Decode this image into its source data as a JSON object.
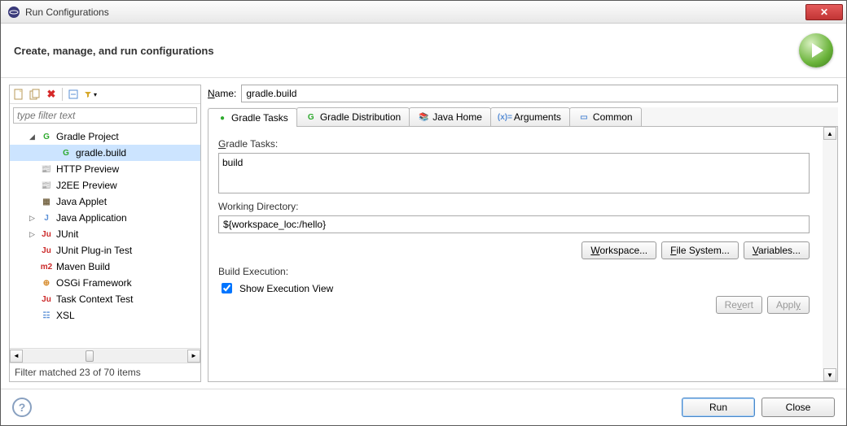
{
  "titlebar": {
    "title": "Run Configurations"
  },
  "header": {
    "title": "Create, manage, and run configurations"
  },
  "left": {
    "filter_placeholder": "type filter text",
    "tree": [
      {
        "label": "Gradle Project",
        "icon": "G",
        "iconColor": "#2faa2f",
        "expandable": true,
        "expanded": true,
        "level": 1
      },
      {
        "label": "gradle.build",
        "icon": "G",
        "iconColor": "#2faa2f",
        "level": 2,
        "selected": true
      },
      {
        "label": "HTTP Preview",
        "icon": "📰",
        "iconColor": "#5a8fd6",
        "level": 1
      },
      {
        "label": "J2EE Preview",
        "icon": "📰",
        "iconColor": "#5a8fd6",
        "level": 1
      },
      {
        "label": "Java Applet",
        "icon": "▦",
        "iconColor": "#7a6a4a",
        "level": 1
      },
      {
        "label": "Java Application",
        "icon": "J",
        "iconColor": "#5a8fd6",
        "expandable": true,
        "expanded": false,
        "level": 1
      },
      {
        "label": "JUnit",
        "icon": "Ju",
        "iconColor": "#cc2a2a",
        "expandable": true,
        "expanded": false,
        "level": 1
      },
      {
        "label": "JUnit Plug-in Test",
        "icon": "Ju",
        "iconColor": "#cc2a2a",
        "level": 1
      },
      {
        "label": "Maven Build",
        "icon": "m2",
        "iconColor": "#cc2a2a",
        "level": 1
      },
      {
        "label": "OSGi Framework",
        "icon": "⊕",
        "iconColor": "#d68a2a",
        "level": 1
      },
      {
        "label": "Task Context Test",
        "icon": "Ju",
        "iconColor": "#cc2a2a",
        "level": 1
      },
      {
        "label": "XSL",
        "icon": "☷",
        "iconColor": "#5a8fd6",
        "level": 1
      }
    ],
    "filter_status": "Filter matched 23 of 70 items"
  },
  "right": {
    "name_label": "Name:",
    "name_value": "gradle.build",
    "tabs": [
      {
        "label": "Gradle Tasks",
        "icon": "●",
        "iconColor": "#2faa2f",
        "active": true
      },
      {
        "label": "Gradle Distribution",
        "icon": "G",
        "iconColor": "#2faa2f"
      },
      {
        "label": "Java Home",
        "icon": "📚",
        "iconColor": "#d68a2a"
      },
      {
        "label": "Arguments",
        "icon": "(x)=",
        "iconColor": "#5a8fd6"
      },
      {
        "label": "Common",
        "icon": "▭",
        "iconColor": "#5a8fd6"
      }
    ],
    "gradle_tasks_label": "Gradle Tasks:",
    "gradle_tasks_value": "build",
    "working_dir_label": "Working Directory:",
    "working_dir_value": "${workspace_loc:/hello}",
    "buttons": {
      "workspace": "Workspace...",
      "filesystem": "File System...",
      "variables": "Variables..."
    },
    "build_exec_label": "Build Execution:",
    "show_exec_label": "Show Execution View",
    "show_exec_checked": true,
    "revert": "Revert",
    "apply": "Apply"
  },
  "footer": {
    "run": "Run",
    "close": "Close"
  }
}
